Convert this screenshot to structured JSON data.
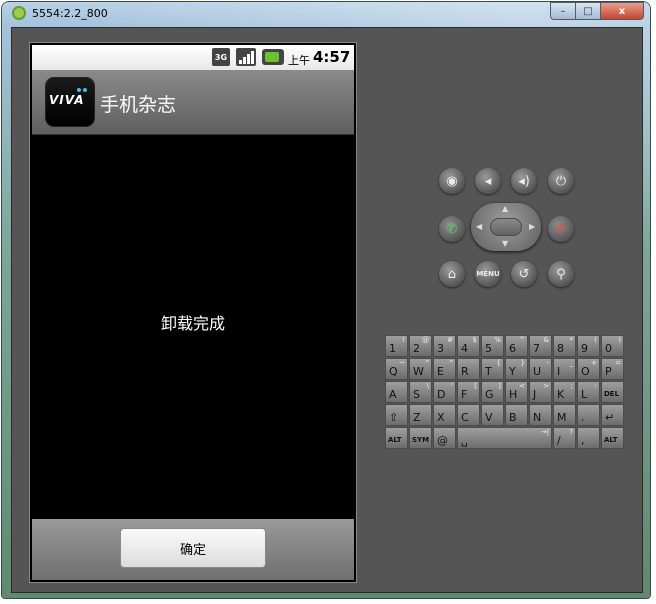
{
  "window": {
    "title": "5554:2.2_800",
    "min_glyph": "–",
    "max_glyph": "□",
    "close_glyph": "x"
  },
  "statusbar": {
    "network": "3G",
    "ampm": "上午",
    "time": "4:57"
  },
  "app": {
    "logo_text": "VIVA",
    "title": "手机杂志",
    "message": "卸载完成",
    "ok_label": "确定"
  },
  "controls": {
    "camera_glyph": "◉",
    "vol_down_glyph": "◂",
    "vol_up_glyph": "◂)",
    "power_glyph": "⏻",
    "call_glyph": "✆",
    "end_glyph": "✆",
    "home_glyph": "⌂",
    "menu_label": "MENU",
    "back_glyph": "↺",
    "search_glyph": "⚲"
  },
  "keyboard": {
    "row1": [
      {
        "main": "1",
        "sub": "!"
      },
      {
        "main": "2",
        "sub": "@"
      },
      {
        "main": "3",
        "sub": "#"
      },
      {
        "main": "4",
        "sub": "$"
      },
      {
        "main": "5",
        "sub": "%"
      },
      {
        "main": "6",
        "sub": "^"
      },
      {
        "main": "7",
        "sub": "&"
      },
      {
        "main": "8",
        "sub": "*"
      },
      {
        "main": "9",
        "sub": "("
      },
      {
        "main": "0",
        "sub": ")"
      }
    ],
    "row2": [
      {
        "main": "Q",
        "sub": "~"
      },
      {
        "main": "W",
        "sub": "\""
      },
      {
        "main": "E",
        "sub": "\""
      },
      {
        "main": "R",
        "sub": ""
      },
      {
        "main": "T",
        "sub": "{"
      },
      {
        "main": "Y",
        "sub": "}"
      },
      {
        "main": "U",
        "sub": "-"
      },
      {
        "main": "I",
        "sub": "_"
      },
      {
        "main": "O",
        "sub": "+"
      },
      {
        "main": "P",
        "sub": "="
      }
    ],
    "row3": [
      {
        "main": "A",
        "sub": ""
      },
      {
        "main": "S",
        "sub": "\\"
      },
      {
        "main": "D",
        "sub": "'"
      },
      {
        "main": "F",
        "sub": "["
      },
      {
        "main": "G",
        "sub": "]"
      },
      {
        "main": "H",
        "sub": "<"
      },
      {
        "main": "J",
        "sub": ">"
      },
      {
        "main": "K",
        "sub": ";"
      },
      {
        "main": "L",
        "sub": ":"
      },
      {
        "main": "DEL",
        "sub": ""
      }
    ],
    "row4": [
      {
        "main": "⇧",
        "sub": ""
      },
      {
        "main": "Z",
        "sub": ""
      },
      {
        "main": "X",
        "sub": ""
      },
      {
        "main": "C",
        "sub": ""
      },
      {
        "main": "V",
        "sub": ""
      },
      {
        "main": "B",
        "sub": ""
      },
      {
        "main": "N",
        "sub": ""
      },
      {
        "main": "M",
        "sub": ""
      },
      {
        "main": ".",
        "sub": ""
      },
      {
        "main": "↵",
        "sub": ""
      }
    ],
    "row5": [
      {
        "main": "ALT",
        "sub": ""
      },
      {
        "main": "SYM",
        "sub": ""
      },
      {
        "main": "@",
        "sub": ""
      },
      {
        "main": "␣",
        "sub": "→|"
      },
      {
        "main": "/",
        "sub": "?"
      },
      {
        "main": ",",
        "sub": ""
      },
      {
        "main": "ALT",
        "sub": ""
      }
    ]
  }
}
